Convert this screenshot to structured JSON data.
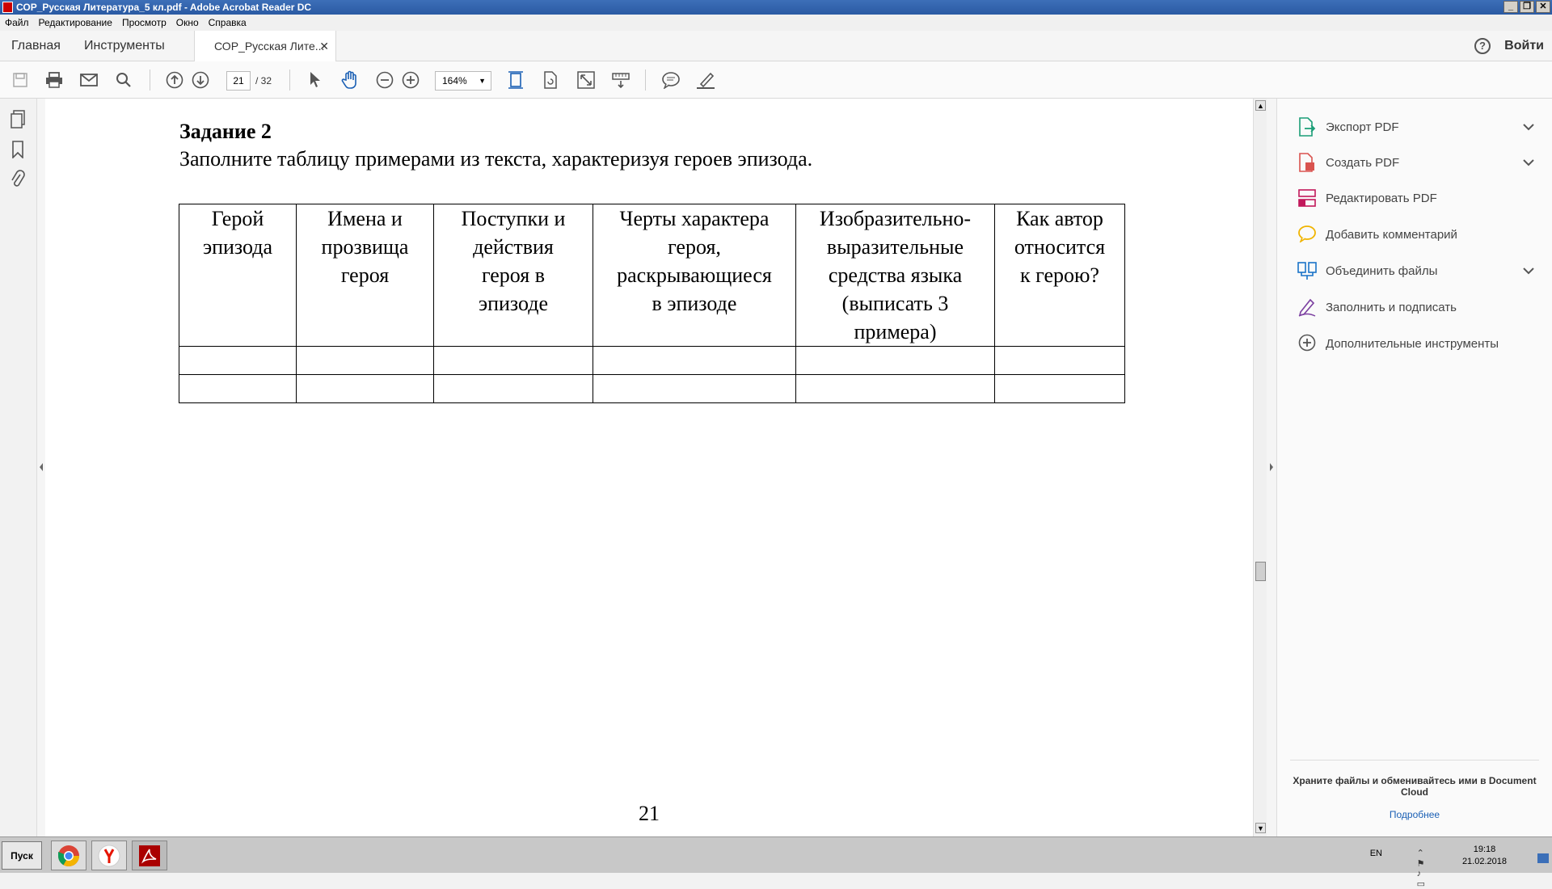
{
  "window": {
    "title": "СОР_Русская Литература_5 кл.pdf - Adobe Acrobat Reader DC",
    "minimize": "_",
    "maximize": "❐",
    "close": "✕"
  },
  "menu": [
    "Файл",
    "Редактирование",
    "Просмотр",
    "Окно",
    "Справка"
  ],
  "tabs": {
    "home": "Главная",
    "tools": "Инструменты",
    "document": "СОР_Русская Лите...",
    "close": "✕",
    "help": "?",
    "login": "Войти"
  },
  "toolbar": {
    "current_page": "21",
    "page_count": "/ 32",
    "zoom": "164%",
    "zoom_dropdown": "▼"
  },
  "document": {
    "heading": "Задание 2",
    "instruction": "Заполните таблицу примерами из текста, характеризуя героев эпизода.",
    "table_headers": [
      [
        "Герой",
        "эпизода"
      ],
      [
        "Имена и",
        "прозвища",
        "героя"
      ],
      [
        "Поступки и",
        "действия",
        "героя в",
        "эпизоде"
      ],
      [
        "Черты характера",
        "героя,",
        "раскрывающиеся",
        "в эпизоде"
      ],
      [
        "Изобразительно-",
        "выразительные",
        "средства языка",
        "(выписать 3",
        "примера)"
      ],
      [
        "Как автор",
        "относится",
        "к герою?"
      ]
    ],
    "empty_rows": 2,
    "page_number": "21"
  },
  "right_panel": {
    "tools": [
      {
        "label": "Экспорт PDF",
        "icon": "export-pdf-icon",
        "chevron": true
      },
      {
        "label": "Создать PDF",
        "icon": "create-pdf-icon",
        "chevron": true
      },
      {
        "label": "Редактировать PDF",
        "icon": "edit-pdf-icon",
        "chevron": false
      },
      {
        "label": "Добавить комментарий",
        "icon": "comment-icon",
        "chevron": false
      },
      {
        "label": "Объединить файлы",
        "icon": "combine-files-icon",
        "chevron": true
      },
      {
        "label": "Заполнить и подписать",
        "icon": "fill-sign-icon",
        "chevron": false
      },
      {
        "label": "Дополнительные инструменты",
        "icon": "more-tools-icon",
        "chevron": false
      }
    ],
    "cloud_text": "Храните файлы и обменивайтесь ими в Document Cloud",
    "cloud_link": "Подробнее"
  },
  "taskbar": {
    "start": "Пуск",
    "lang": "EN",
    "time": "19:18",
    "date": "21.02.2018"
  },
  "colors": {
    "titlebar": "#2a5aa3",
    "link": "#1a5fb4",
    "export": "#1b9e77",
    "create": "#d9534f",
    "edit": "#c2185b",
    "comment": "#f0b400",
    "combine": "#1a73c8",
    "fill": "#7b3fa0",
    "more": "#555555"
  }
}
